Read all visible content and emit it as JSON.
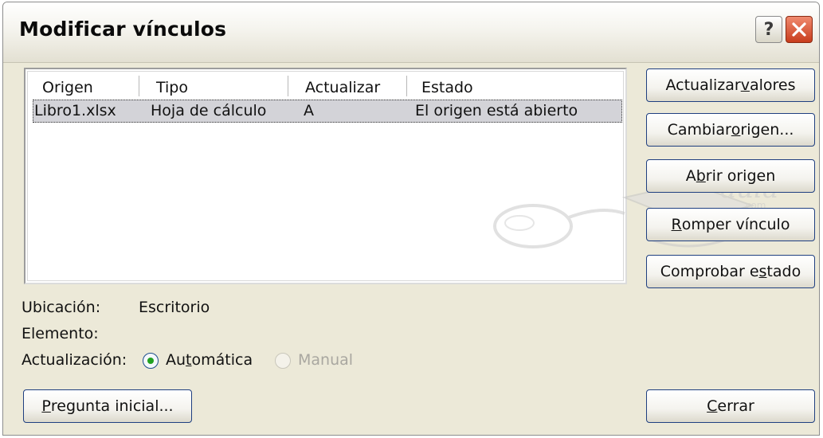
{
  "window": {
    "title": "Modificar vínculos"
  },
  "titlebar": {
    "help_glyph": "?",
    "close_glyph": "✕"
  },
  "list": {
    "columns": [
      "Origen",
      "Tipo",
      "Actualizar",
      "Estado"
    ],
    "rows": [
      {
        "origen": "Libro1.xlsx",
        "tipo": "Hoja de cálculo",
        "actualizar": "A",
        "estado": "El origen está abierto"
      }
    ]
  },
  "buttons": {
    "actualizar_valores": {
      "pre": "Actualizar ",
      "key": "v",
      "post": "alores"
    },
    "cambiar_origen": {
      "pre": "Cambiar ",
      "key": "o",
      "post": "rigen..."
    },
    "abrir_origen": {
      "pre": "A",
      "key": "b",
      "post": "rir origen"
    },
    "romper_vinculo": {
      "pre": "",
      "key": "R",
      "post": "omper vínculo"
    },
    "comprobar_estado": {
      "pre": "Comprobar e",
      "key": "s",
      "post": "tado"
    },
    "pregunta_inicial": {
      "pre": "",
      "key": "P",
      "post": "regunta inicial..."
    },
    "cerrar": {
      "pre": "",
      "key": "C",
      "post": "errar"
    }
  },
  "info": {
    "ubicacion_label": "Ubicación:",
    "ubicacion_value": "Escritorio",
    "elemento_label": "Elemento:",
    "actualizacion_label": "Actualización:",
    "automatica": {
      "pre": "Au",
      "key": "t",
      "post": "omática",
      "selected": true
    },
    "manual": {
      "label": "Manual",
      "disabled": true
    }
  },
  "watermark": {
    "text": "aula",
    "text2": "clic",
    "text3": ".com"
  }
}
